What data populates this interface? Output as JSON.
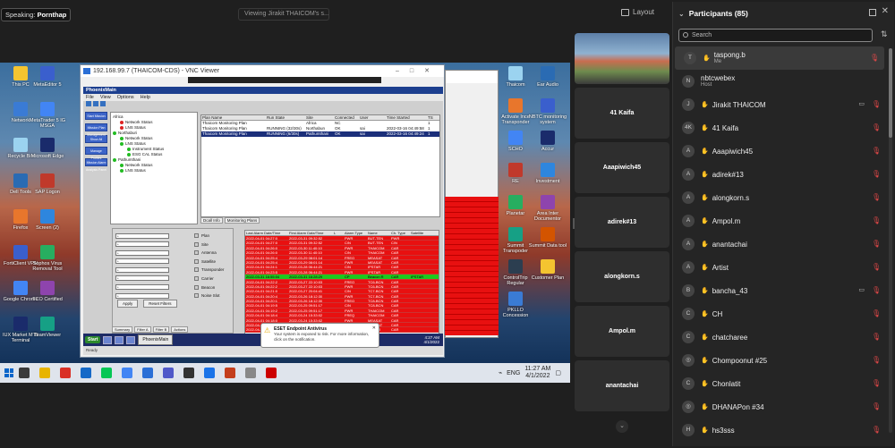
{
  "top": {
    "speaking_label": "Speaking:",
    "speaking_name": "Pornthap",
    "viewing": "Viewing Jirakit THAICOM's s...",
    "layout": "Layout"
  },
  "desktop": {
    "left_icons": [
      "This PC",
      "Network",
      "Recycle Bin",
      "Dell Tools",
      "Firefox",
      "FortiClient VPN",
      "Google Chrome",
      "IUX Market MT5 Terminal"
    ],
    "col2_icons": [
      "MetaEditor 5",
      "MetaTrader 5 IG MSGA",
      "Microsoft Edge",
      "SAP Logon",
      "Screen (2)",
      "Sophos Virus Removal Tool",
      "TCO Certified",
      "TeamViewer"
    ],
    "right_icons": [
      "Thaicom",
      "Ear Audio",
      "Activate Ince Transponder",
      "NBTC monitoring system",
      "SCHO",
      "Accur",
      "RE",
      "Investment",
      "Planetar",
      "Area Inter Documentor",
      "Summit Transpoder",
      "Summit Data tool",
      "ControlTrip Regular",
      "Customer Plan",
      "PKLLO Concession"
    ]
  },
  "vnc": {
    "title": "192.168.99.7 (THAICOM-CDS) - VNC Viewer",
    "inner_title": "PhoenixMain",
    "menu": [
      "File",
      "View",
      "Options",
      "Help"
    ],
    "left_buttons": [
      "Start Mission",
      "Mission Plan Management",
      "Show All",
      "Manage Profiles",
      "Mission Alarm Analysis Panel"
    ],
    "tree": [
      {
        "t": "Africa",
        "s": "none"
      },
      {
        "t": "Network Status",
        "s": "red"
      },
      {
        "t": "LNS Status",
        "s": "red"
      },
      {
        "t": "Northaburi",
        "s": "green"
      },
      {
        "t": "Network Status",
        "s": "green"
      },
      {
        "t": "LNS Status",
        "s": "green"
      },
      {
        "t": "Instrument Status",
        "s": "green"
      },
      {
        "t": "ESG CAL Status",
        "s": "green"
      },
      {
        "t": "Pathumthani",
        "s": "green"
      },
      {
        "t": "Network Status",
        "s": "green"
      },
      {
        "t": "LNS Status",
        "s": "green"
      }
    ],
    "plans_header": [
      "Plan Name",
      "Run State",
      "Site",
      "Connected",
      "User",
      "Time Started",
      "TS"
    ],
    "plans_rows": [
      [
        "Thaicom Monitoring Plan",
        "",
        "Africa",
        "NC",
        "",
        "",
        "1"
      ],
      [
        "Thaicom Monitoring Plan",
        "RUNNING (32/30s)",
        "Northabun",
        "OK",
        "sai",
        "2022-03-16 04:49:58",
        "1"
      ],
      [
        "Thaicom Monitoring Plan",
        "RUNNING (6/30s)",
        "Pathumthani",
        "OK",
        "sai",
        "2022-03-16 04:49:24",
        "1"
      ]
    ],
    "plan_tabs": [
      "Dcall Info",
      "Monitoring Plans"
    ],
    "filter_labels": [
      "Plan",
      "Site",
      "Antenna",
      "Satellite",
      "Transponder",
      "Carrier",
      "Beacon",
      "Noise Slot"
    ],
    "filter_value": "*",
    "apply": "Apply",
    "reset": "Reset Filters",
    "filter_tabs": [
      "Summary",
      "Filter A",
      "Filter B",
      "Actions"
    ],
    "alarm_header": [
      "Last Alarm Date/Time",
      "First Alarm Date/Time",
      "L",
      "Alarm Type",
      "Name",
      "Ch. Type",
      "Satellite"
    ],
    "alarm_rows": [
      {
        "c": "red",
        "v": [
          "2022-04-01 04:27:0",
          "2022-03-31 09:32:52",
          "",
          "PWR",
          "BUT-TEN",
          "PWR",
          ""
        ]
      },
      {
        "c": "red",
        "v": [
          "2022-04-01 04:27:0",
          "2022-03-31 09:32:52",
          "",
          "C/N",
          "BUT-TEN",
          "C/N",
          ""
        ]
      },
      {
        "c": "red",
        "v": [
          "2022-04-01 04:26:0",
          "2022-03-30 11:40:10",
          "",
          "PWR",
          "THAICOM",
          "CAR",
          ""
        ]
      },
      {
        "c": "red",
        "v": [
          "2022-04-01 04:26:0",
          "2022-03-30 11:40:10",
          "",
          "C/N",
          "THAICOM",
          "CAR",
          ""
        ]
      },
      {
        "c": "red",
        "v": [
          "2022-04-01 04:25:4",
          "2022-03-29 08:01:14",
          "",
          "FREQ",
          "MEASAT",
          "CAR",
          ""
        ]
      },
      {
        "c": "red",
        "v": [
          "2022-04-01 04:25:4",
          "2022-03-29 08:01:14",
          "",
          "PWR",
          "MEASAT",
          "CAR",
          ""
        ]
      },
      {
        "c": "red",
        "v": [
          "2022-04-01 04:24:1",
          "2022-03-28 06:44:21",
          "",
          "C/N",
          "IPSTAR",
          "CAR",
          ""
        ]
      },
      {
        "c": "red",
        "v": [
          "2022-04-01 04:23:5",
          "2022-03-28 06:44:21",
          "",
          "PWR",
          "IPSTAR",
          "CAR",
          ""
        ]
      },
      {
        "c": "green",
        "v": [
          "2022-03-31 16:55:04",
          "2022-03-31 16:28:29",
          "",
          "CP",
          "Beacon R",
          "CAR",
          "IPSTAR"
        ]
      },
      {
        "c": "red",
        "v": [
          "2022-04-01 04:22:2",
          "2022-03-27 22:10:03",
          "",
          "FREQ",
          "TC6-BCN",
          "CAR",
          ""
        ]
      },
      {
        "c": "red",
        "v": [
          "2022-04-01 04:22:2",
          "2022-03-27 22:10:03",
          "",
          "PWR",
          "TC6-BCN",
          "CAR",
          ""
        ]
      },
      {
        "c": "red",
        "v": [
          "2022-04-01 04:21:0",
          "2022-03-27 20:04:41",
          "",
          "C/N",
          "TC7-BCN",
          "CAR",
          ""
        ]
      },
      {
        "c": "red",
        "v": [
          "2022-04-01 04:20:4",
          "2022-03-26 18:12:30",
          "",
          "PWR",
          "TC7-BCN",
          "CAR",
          ""
        ]
      },
      {
        "c": "red",
        "v": [
          "2022-04-01 04:20:1",
          "2022-03-26 18:12:30",
          "",
          "FREQ",
          "TC8-BCN",
          "CAR",
          ""
        ]
      },
      {
        "c": "red",
        "v": [
          "2022-04-01 04:19:5",
          "2022-03-25 09:51:17",
          "",
          "C/N",
          "TC8-BCN",
          "CAR",
          ""
        ]
      },
      {
        "c": "red",
        "v": [
          "2022-04-01 04:19:2",
          "2022-03-25 09:51:17",
          "",
          "PWR",
          "THAICOM",
          "CAR",
          ""
        ]
      },
      {
        "c": "red",
        "v": [
          "2022-04-01 04:18:4",
          "2022-03-24 15:33:02",
          "",
          "FREQ",
          "THAICOM",
          "CAR",
          ""
        ]
      },
      {
        "c": "red",
        "v": [
          "2022-04-01 04:18:0",
          "2022-03-24 15:33:02",
          "",
          "PWR",
          "MEASAT",
          "CAR",
          ""
        ]
      },
      {
        "c": "red",
        "v": [
          "2022-04-01 04:17:3",
          "2022-03-23 12:20:48",
          "",
          "C/N",
          "MEASAT",
          "CAR",
          ""
        ]
      },
      {
        "c": "red",
        "v": [
          "2022-04-01 04:17:0",
          "2022-03-23 12:20:48",
          "",
          "PWR",
          "IPSTAR",
          "CAR",
          ""
        ]
      }
    ],
    "status": "Ready",
    "start": "Start",
    "app": "PhoenixMain",
    "inner_clock_time": "4:27 AM",
    "inner_clock_date": "4/1/2022"
  },
  "eset": {
    "title": "ESET Endpoint Antivirus",
    "body": "Your system is exposed to risk. For more information, click on the notification."
  },
  "taskbar": {
    "lang": "ENG",
    "time": "11:27 AM",
    "date": "4/1/2022"
  },
  "gallery": [
    "",
    "41 Kaifa",
    "Aaapiwich45",
    "adirek#13",
    "alongkorn.s",
    "Ampol.m",
    "anantachai"
  ],
  "panel": {
    "title": "Participants (85)",
    "search_placeholder": "Search",
    "participants": [
      {
        "name": "taspong.b",
        "sub": "Me",
        "av": "T",
        "hand": true,
        "cam": false,
        "me": true
      },
      {
        "name": "nbtcwebex",
        "sub": "Host",
        "av": "N",
        "hand": false,
        "cam": false,
        "me": false
      },
      {
        "name": "Jirakit THAICOM",
        "sub": "",
        "av": "J",
        "hand": true,
        "cam": true,
        "me": false
      },
      {
        "name": "41 Kaifa",
        "sub": "",
        "av": "4K",
        "hand": true,
        "cam": false,
        "me": false
      },
      {
        "name": "Aaapiwich45",
        "sub": "",
        "av": "A",
        "hand": true,
        "cam": false,
        "me": false
      },
      {
        "name": "adirek#13",
        "sub": "",
        "av": "A",
        "hand": true,
        "cam": false,
        "me": false
      },
      {
        "name": "alongkorn.s",
        "sub": "",
        "av": "A",
        "hand": true,
        "cam": false,
        "me": false
      },
      {
        "name": "Ampol.m",
        "sub": "",
        "av": "A",
        "hand": true,
        "cam": false,
        "me": false
      },
      {
        "name": "anantachai",
        "sub": "",
        "av": "A",
        "hand": true,
        "cam": false,
        "me": false
      },
      {
        "name": "Artist",
        "sub": "",
        "av": "A",
        "hand": true,
        "cam": false,
        "me": false
      },
      {
        "name": "bancha_43",
        "sub": "",
        "av": "B",
        "hand": true,
        "cam": true,
        "me": false
      },
      {
        "name": "CH",
        "sub": "",
        "av": "C",
        "hand": true,
        "cam": false,
        "me": false
      },
      {
        "name": "chatcharee",
        "sub": "",
        "av": "C",
        "hand": true,
        "cam": false,
        "me": false
      },
      {
        "name": "Chompoonut #25",
        "sub": "",
        "av": "",
        "hand": true,
        "cam": false,
        "me": false
      },
      {
        "name": "Chonlatit",
        "sub": "",
        "av": "C",
        "hand": true,
        "cam": false,
        "me": false
      },
      {
        "name": "DHANAPon #34",
        "sub": "",
        "av": "",
        "hand": true,
        "cam": false,
        "me": false
      },
      {
        "name": "hs3sss",
        "sub": "",
        "av": "H",
        "hand": true,
        "cam": false,
        "me": false
      }
    ]
  }
}
